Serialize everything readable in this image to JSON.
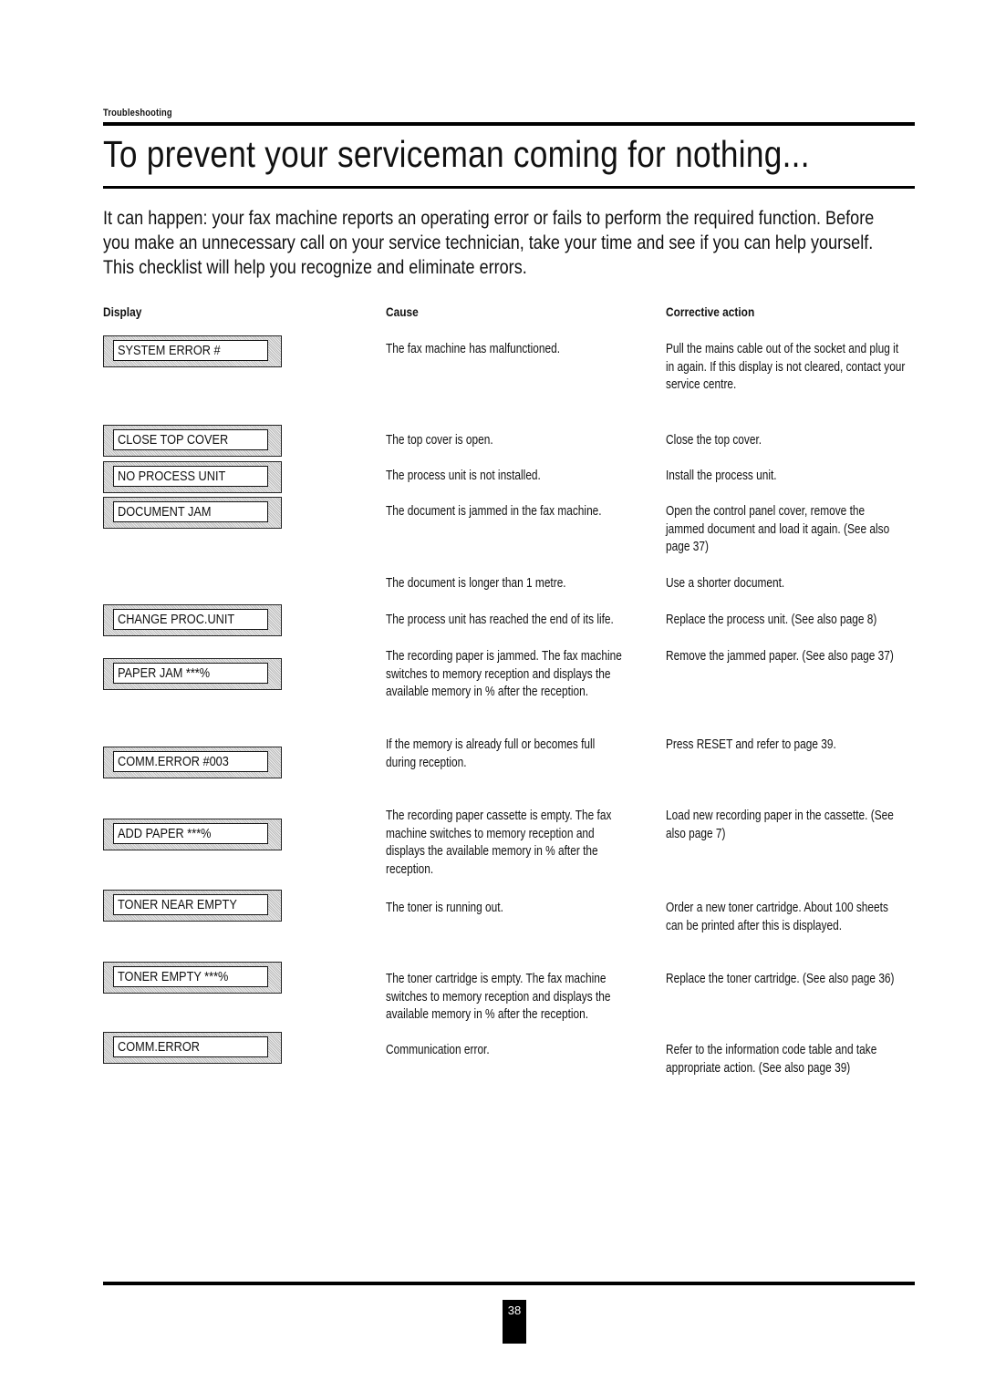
{
  "header": {
    "section": "Troubleshooting",
    "title": "To prevent your serviceman coming for nothing...",
    "intro": "It can happen: your fax machine reports an operating error or fails to perform the required function. Before you make an unnecessary call on your service technician, take your time and see if you can help yourself. This checklist will help you recognize and eliminate errors."
  },
  "columns": {
    "display": "Display",
    "cause": "Cause",
    "action": "Corrective action"
  },
  "displays": [
    "SYSTEM ERROR #",
    "CLOSE TOP COVER",
    "NO PROCESS UNIT",
    "DOCUMENT JAM",
    "CHANGE PROC.UNIT",
    "PAPER JAM ***%",
    "COMM.ERROR #003",
    "ADD PAPER ***%",
    "TONER NEAR EMPTY",
    "TONER EMPTY ***%",
    "COMM.ERROR"
  ],
  "rows": [
    {
      "cause": "The fax machine has malfunctioned.",
      "action": "Pull the mains cable out of the socket and plug it in again. If this display is not cleared, contact your service centre."
    },
    {
      "cause": "The top cover is open.",
      "action": "Close the top cover."
    },
    {
      "cause": "The process unit is not installed.",
      "action": "Install the process unit."
    },
    {
      "cause": "The document is jammed in the fax machine.",
      "action": "Open the control panel cover, remove the jammed document and load it again. (See also page 37)"
    },
    {
      "cause": "The document is longer than 1 metre.",
      "action": "Use a shorter document."
    },
    {
      "cause": "The process unit has reached the end of its life.",
      "action": "Replace the process unit. (See also page 8)"
    },
    {
      "cause": "The recording paper is jammed. The fax machine switches to memory reception and displays the available memory in % after the reception.",
      "action": "Remove the jammed paper. (See also page 37)"
    },
    {
      "cause": "If the memory is already full or becomes full during reception.",
      "action": "Press RESET and refer to page 39."
    },
    {
      "cause": "The recording paper cassette is empty. The fax machine switches to memory reception and displays the available memory in % after the reception.",
      "action": "Load new recording paper in the cassette. (See also page 7)"
    },
    {
      "cause": "The toner is running out.",
      "action": "Order a new toner cartridge. About 100 sheets can be printed after this is displayed."
    },
    {
      "cause": "The toner cartridge is empty. The fax machine switches to memory reception and displays the available memory in % after the reception.",
      "action": "Replace the toner cartridge. (See also page 36)"
    },
    {
      "cause": "Communication error.",
      "action": "Refer to the information code table and take appropriate action. (See also page 39)"
    }
  ],
  "footer": {
    "page_number": "38"
  }
}
